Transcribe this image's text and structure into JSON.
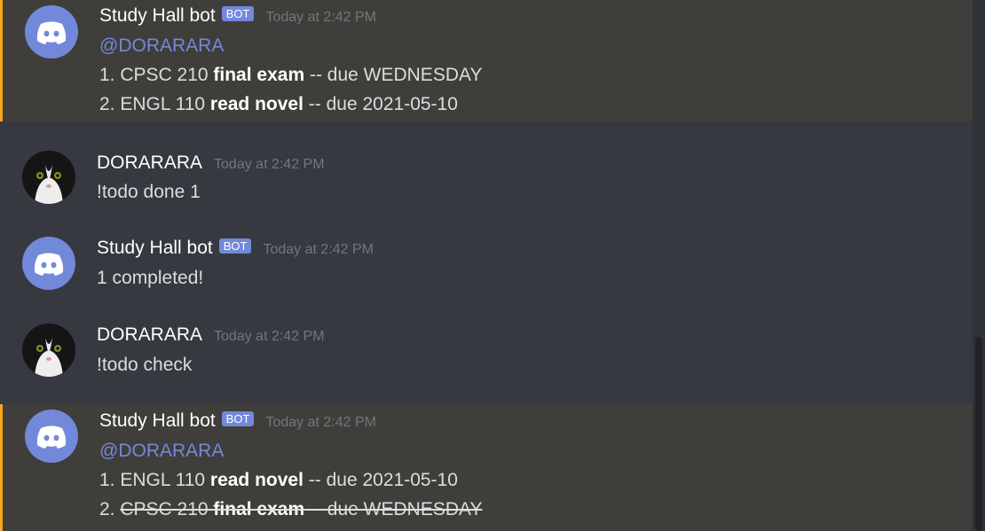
{
  "messages": [
    {
      "author": "Study Hall bot",
      "badge": "BOT",
      "time": "Today at 2:42 PM",
      "mention": "@DORARARA",
      "items": [
        {
          "prefix": "1. CPSC 210 ",
          "bold": "final exam",
          "suffix": " -- due WEDNESDAY"
        },
        {
          "prefix": "2. ENGL 110 ",
          "bold": "read novel",
          "suffix": " -- due 2021-05-10"
        }
      ]
    },
    {
      "author": "DORARARA",
      "time": "Today at 2:42 PM",
      "text": "!todo done 1"
    },
    {
      "author": "Study Hall bot",
      "badge": "BOT",
      "time": "Today at 2:42 PM",
      "text": "1 completed!"
    },
    {
      "author": "DORARARA",
      "time": "Today at 2:42 PM",
      "text": "!todo check"
    },
    {
      "author": "Study Hall bot",
      "badge": "BOT",
      "time": "Today at 2:42 PM",
      "mention": "@DORARARA",
      "items": [
        {
          "prefix": "1. ENGL 110 ",
          "bold": "read novel",
          "suffix": " -- due 2021-05-10"
        },
        {
          "num": "2. ",
          "prefix": "CPSC 210 ",
          "bold": "final exam",
          "suffix": " -- due WEDNESDAY",
          "struck": true
        }
      ]
    }
  ],
  "colors": {
    "background": "#36393f",
    "mention_highlight": "#403e3b",
    "mention_border": "#faa81a",
    "blurple": "#7289da"
  },
  "icons": {
    "bot_avatar": "discord-logo-icon",
    "user_avatar": "cat-photo-avatar"
  }
}
